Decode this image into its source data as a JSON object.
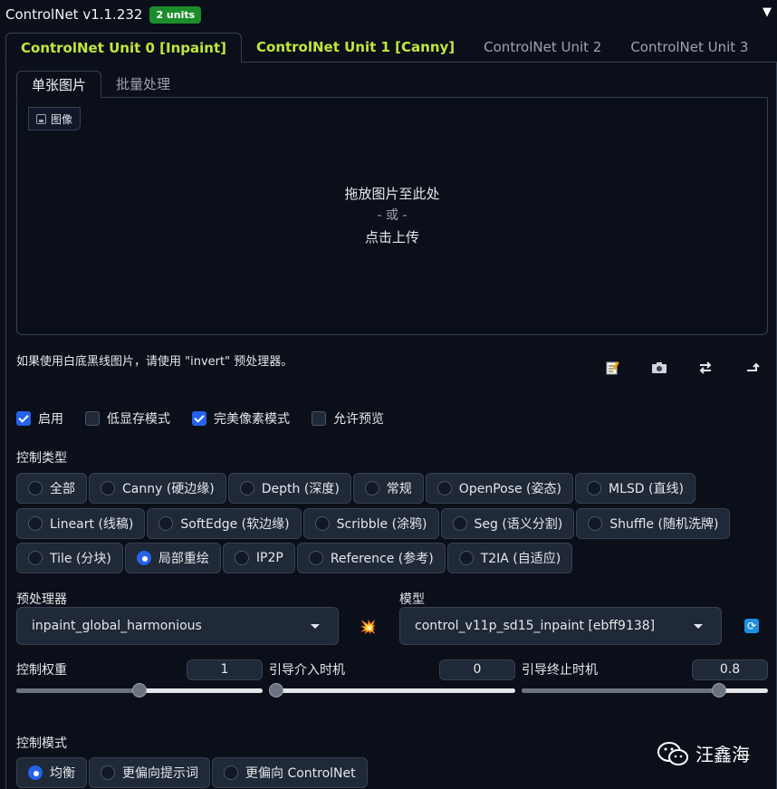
{
  "header": {
    "title": "ControlNet v1.1.232",
    "badge": "2 units",
    "collapse_icon": "triangle-down"
  },
  "unit_tabs": [
    {
      "label": "ControlNet Unit 0 [Inpaint]",
      "active": true,
      "highlight": true
    },
    {
      "label": "ControlNet Unit 1 [Canny]",
      "active": false,
      "highlight": true
    },
    {
      "label": "ControlNet Unit 2",
      "active": false,
      "highlight": false
    },
    {
      "label": "ControlNet Unit 3",
      "active": false,
      "highlight": false
    }
  ],
  "image_tabs": [
    {
      "label": "单张图片",
      "active": true
    },
    {
      "label": "批量处理",
      "active": false
    }
  ],
  "dropzone": {
    "label": "图像",
    "line1": "拖放图片至此处",
    "line2": "- 或 -",
    "line3": "点击上传"
  },
  "hint": "如果使用白底黑线图片，请使用 \"invert\" 预处理器。",
  "tool_icons": [
    "memo-icon",
    "camera-icon",
    "swap-icon",
    "send-dimensions-icon"
  ],
  "checkboxes": [
    {
      "label": "启用",
      "checked": true
    },
    {
      "label": "低显存模式",
      "checked": false
    },
    {
      "label": "完美像素模式",
      "checked": true
    },
    {
      "label": "允许预览",
      "checked": false
    }
  ],
  "control_type": {
    "label": "控制类型",
    "rows": [
      [
        {
          "label": "全部",
          "selected": false
        },
        {
          "label": "Canny (硬边缘)",
          "selected": false
        },
        {
          "label": "Depth (深度)",
          "selected": false
        },
        {
          "label": "常规",
          "selected": false
        },
        {
          "label": "OpenPose (姿态)",
          "selected": false
        },
        {
          "label": "MLSD (直线)",
          "selected": false
        }
      ],
      [
        {
          "label": "Lineart (线稿)",
          "selected": false
        },
        {
          "label": "SoftEdge (软边缘)",
          "selected": false
        },
        {
          "label": "Scribble (涂鸦)",
          "selected": false
        },
        {
          "label": "Seg (语义分割)",
          "selected": false
        },
        {
          "label": "Shuffle (随机洗牌)",
          "selected": false
        }
      ],
      [
        {
          "label": "Tile (分块)",
          "selected": false
        },
        {
          "label": "局部重绘",
          "selected": true
        },
        {
          "label": "IP2P",
          "selected": false
        },
        {
          "label": "Reference (参考)",
          "selected": false
        },
        {
          "label": "T2IA (自适应)",
          "selected": false
        }
      ]
    ]
  },
  "preprocessor": {
    "label": "预处理器",
    "value": "inpaint_global_harmonious"
  },
  "model": {
    "label": "模型",
    "value": "control_v11p_sd15_inpaint [ebff9138]"
  },
  "sliders": [
    {
      "label": "控制权重",
      "value": "1",
      "fraction": 0.5
    },
    {
      "label": "引导介入时机",
      "value": "0",
      "fraction": 0.0
    },
    {
      "label": "引导终止时机",
      "value": "0.8",
      "fraction": 0.8
    }
  ],
  "control_mode": {
    "label": "控制模式",
    "options": [
      {
        "label": "均衡",
        "selected": true
      },
      {
        "label": "更偏向提示词",
        "selected": false
      },
      {
        "label": "更偏向 ControlNet",
        "selected": false
      }
    ]
  },
  "watermark": {
    "text": "汪鑫海"
  },
  "colors": {
    "accent": "#2563eb",
    "tab_highlight": "#c1e63c",
    "badge": "#1c8d2b",
    "background": "#0b0f19"
  }
}
